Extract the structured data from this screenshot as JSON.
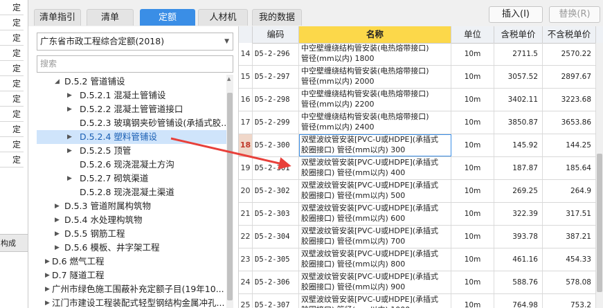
{
  "left_strip": {
    "cells": [
      "定",
      "定",
      "定",
      "定",
      "定",
      "定",
      "定",
      "定",
      "定",
      "定",
      "定"
    ],
    "group_label": "构成"
  },
  "tabs": [
    {
      "label": "清单指引",
      "active": false
    },
    {
      "label": "清单",
      "active": false
    },
    {
      "label": "定额",
      "active": true
    },
    {
      "label": "人材机",
      "active": false
    },
    {
      "label": "我的数据",
      "active": false
    }
  ],
  "toolbar": {
    "insert_label": "插入(I)",
    "replace_label": "替换(R)"
  },
  "library": {
    "selected": "广东省市政工程综合定额(2018)"
  },
  "search": {
    "placeholder": "搜索"
  },
  "tree": [
    {
      "level": 2,
      "arrow": "◢",
      "label": "D.5.2 管道铺设"
    },
    {
      "level": 3,
      "arrow": "▶",
      "label": "D.5.2.1 混凝土管铺设"
    },
    {
      "level": 3,
      "arrow": "▶",
      "label": "D.5.2.2 混凝土管管道接口"
    },
    {
      "level": 3,
      "arrow": "",
      "label": "D.5.2.3 玻璃钢夹砂管铺设(承插式胶..."
    },
    {
      "level": 3,
      "arrow": "▶",
      "label": "D.5.2.4 塑料管铺设",
      "selected": true
    },
    {
      "level": 3,
      "arrow": "▶",
      "label": "D.5.2.5 顶管"
    },
    {
      "level": 3,
      "arrow": "",
      "label": "D.5.2.6 现浇混凝土方沟"
    },
    {
      "level": 3,
      "arrow": "▶",
      "label": "D.5.2.7 砌筑渠道"
    },
    {
      "level": 3,
      "arrow": "",
      "label": "D.5.2.8 现浇混凝土渠道"
    },
    {
      "level": 2,
      "arrow": "▶",
      "label": "D.5.3 管道附属构筑物"
    },
    {
      "level": 2,
      "arrow": "▶",
      "label": "D.5.4 水处理构筑物"
    },
    {
      "level": 2,
      "arrow": "▶",
      "label": "D.5.5 钢筋工程"
    },
    {
      "level": 2,
      "arrow": "▶",
      "label": "D.5.6 模板、井字架工程"
    },
    {
      "level": 1,
      "arrow": "▶",
      "label": "D.6 燃气工程"
    },
    {
      "level": 1,
      "arrow": "▶",
      "label": "D.7 隧道工程"
    },
    {
      "level": 1,
      "arrow": "▶",
      "label": "广州市绿色施工围蔽补充定额子目(19年10..."
    },
    {
      "level": 1,
      "arrow": "▶",
      "label": "江门市建设工程装配式轻型钢结构金属冲孔..."
    }
  ],
  "grid": {
    "columns": [
      "编码",
      "名称",
      "单位",
      "含税单价",
      "不含税单价"
    ],
    "rows": [
      {
        "idx": "14",
        "code": "D5-2-296",
        "name1": "中空壁缠绕结构管安装(电热熔带接口)",
        "name2": "管径(mm以内) 1800",
        "unit": "10m",
        "p1": "2711.5",
        "p2": "2570.22"
      },
      {
        "idx": "15",
        "code": "D5-2-297",
        "name1": "中空壁缠绕结构管安装(电热熔带接口)",
        "name2": "管径(mm以内) 2000",
        "unit": "10m",
        "p1": "3057.52",
        "p2": "2897.67"
      },
      {
        "idx": "16",
        "code": "D5-2-298",
        "name1": "中空壁缠绕结构管安装(电热熔带接口)",
        "name2": "管径(mm以内) 2200",
        "unit": "10m",
        "p1": "3402.11",
        "p2": "3223.68"
      },
      {
        "idx": "17",
        "code": "D5-2-299",
        "name1": "中空壁缠绕结构管安装(电热熔带接口)",
        "name2": "管径(mm以内) 2400",
        "unit": "10m",
        "p1": "3850.87",
        "p2": "3653.86"
      },
      {
        "idx": "18",
        "code": "D5-2-300",
        "name1": "双壁波纹管安装[PVC-U或HDPE](承插式",
        "name2": "胶圈接口) 管径(mm以内) 300",
        "unit": "10m",
        "p1": "145.92",
        "p2": "144.25",
        "current": true
      },
      {
        "idx": "19",
        "code": "D5-2-301",
        "name1": "双壁波纹管安装[PVC-U或HDPE](承插式",
        "name2": "胶圈接口) 管径(mm以内) 400",
        "unit": "10m",
        "p1": "187.87",
        "p2": "185.64"
      },
      {
        "idx": "20",
        "code": "D5-2-302",
        "name1": "双壁波纹管安装[PVC-U或HDPE](承插式",
        "name2": "胶圈接口) 管径(mm以内) 500",
        "unit": "10m",
        "p1": "269.25",
        "p2": "264.9"
      },
      {
        "idx": "21",
        "code": "D5-2-303",
        "name1": "双壁波纹管安装[PVC-U或HDPE](承插式",
        "name2": "胶圈接口) 管径(mm以内) 600",
        "unit": "10m",
        "p1": "322.39",
        "p2": "317.51"
      },
      {
        "idx": "22",
        "code": "D5-2-304",
        "name1": "双壁波纹管安装[PVC-U或HDPE](承插式",
        "name2": "胶圈接口) 管径(mm以内) 700",
        "unit": "10m",
        "p1": "393.78",
        "p2": "387.21"
      },
      {
        "idx": "23",
        "code": "D5-2-305",
        "name1": "双壁波纹管安装[PVC-U或HDPE](承插式",
        "name2": "胶圈接口) 管径(mm以内) 800",
        "unit": "10m",
        "p1": "461.16",
        "p2": "454.33"
      },
      {
        "idx": "24",
        "code": "D5-2-306",
        "name1": "双壁波纹管安装[PVC-U或HDPE](承插式",
        "name2": "胶圈接口) 管径(mm以内) 900",
        "unit": "10m",
        "p1": "588.76",
        "p2": "578.08"
      },
      {
        "idx": "25",
        "code": "D5-2-307",
        "name1": "双壁波纹管安装[PVC-U或HDPE](承插式",
        "name2": "胶圈接口) 管径(mm以内) 1000",
        "unit": "10m",
        "p1": "764.98",
        "p2": "753.2"
      }
    ]
  },
  "colors": {
    "accent": "#3a8ee6",
    "name_header": "#fcd84a",
    "selected_node": "#cfe4fb",
    "arrow": "#e8403a"
  }
}
